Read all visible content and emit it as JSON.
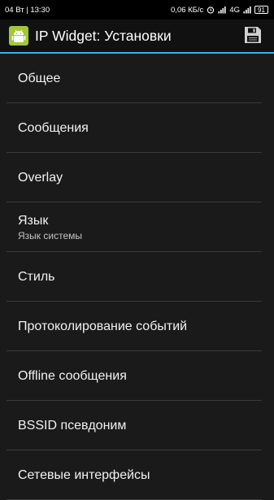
{
  "status_bar": {
    "left_text": "04 Вт | 13:30",
    "speed": "0,06 КБ/с",
    "network_type": "4G",
    "battery_level": "91",
    "icons": [
      "alarm-icon",
      "signal-icon",
      "signal-icon",
      "battery-icon"
    ]
  },
  "action_bar": {
    "title": "IP Widget: Установки",
    "app_icon": "android-robot-icon",
    "save_icon": "floppy-disk-icon",
    "accent_color": "#33b5e5",
    "icon_color": "#a4c639"
  },
  "preferences": [
    {
      "title": "Общее",
      "summary": ""
    },
    {
      "title": "Сообщения",
      "summary": ""
    },
    {
      "title": "Overlay",
      "summary": ""
    },
    {
      "title": "Язык",
      "summary": "Язык системы"
    },
    {
      "title": "Стиль",
      "summary": ""
    },
    {
      "title": "Протоколирование событий",
      "summary": ""
    },
    {
      "title": "Offline сообщения",
      "summary": ""
    },
    {
      "title": "BSSID псевдоним",
      "summary": ""
    },
    {
      "title": "Сетевые интерфейсы",
      "summary": ""
    }
  ]
}
